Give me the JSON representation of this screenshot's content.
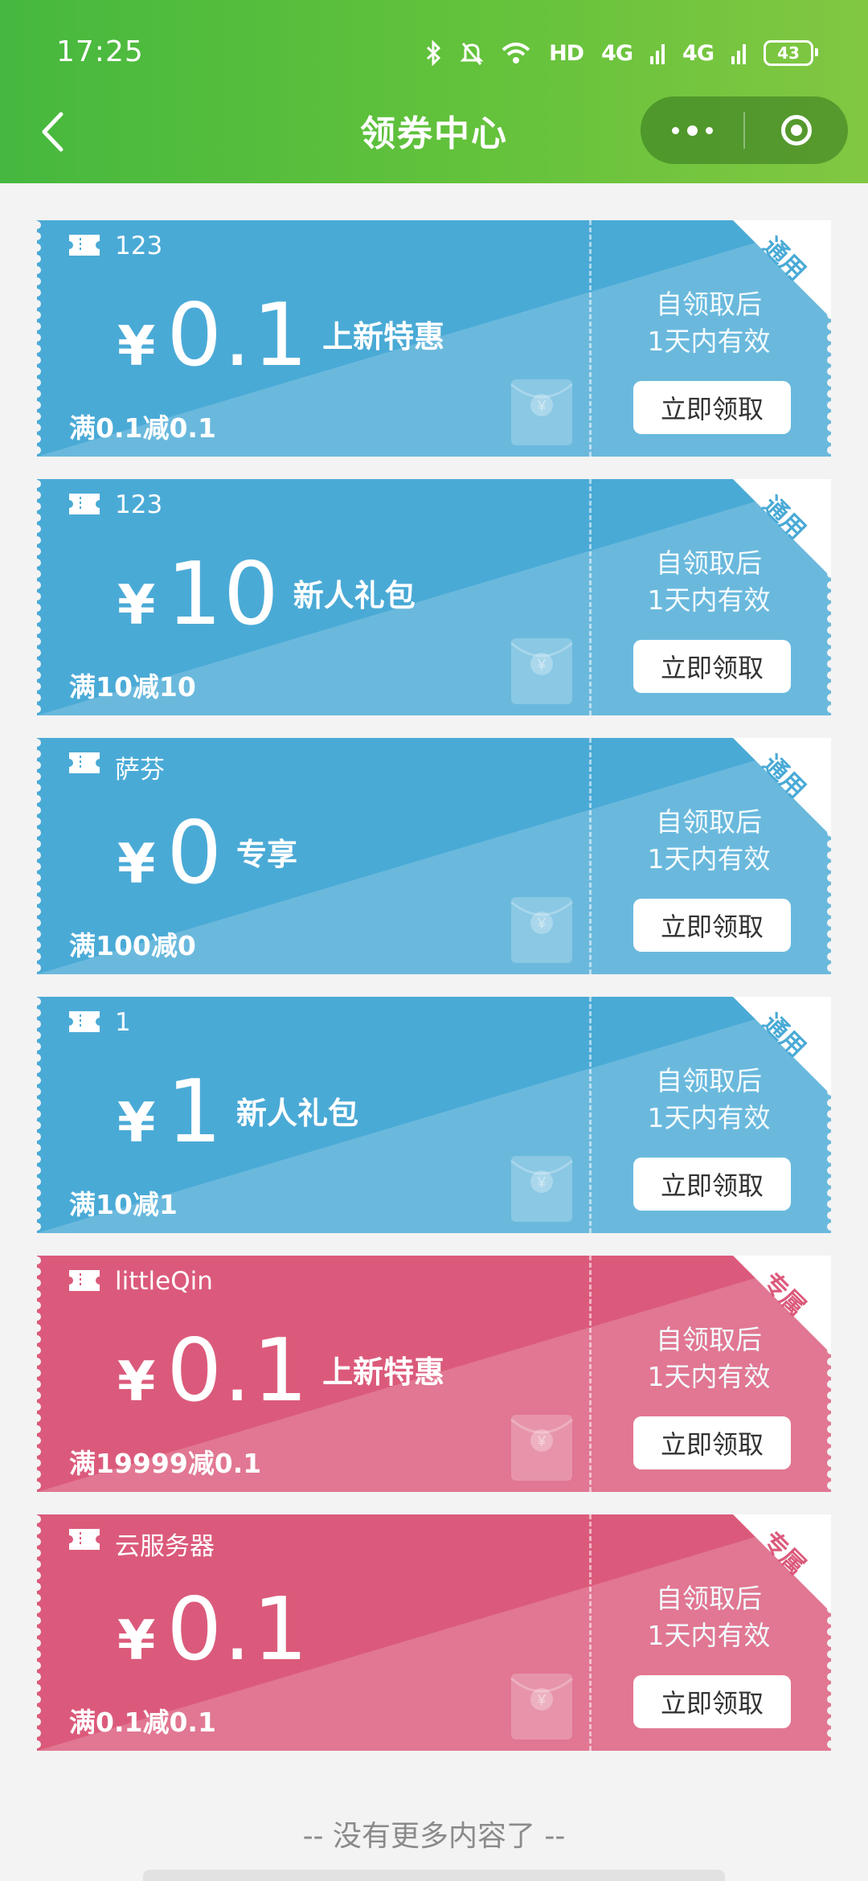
{
  "status_bar": {
    "time": "17:25",
    "hd": "HD",
    "net1": "4G",
    "net2": "4G",
    "battery": "43"
  },
  "header": {
    "title": "领券中心"
  },
  "coupons": [
    {
      "shop": "123",
      "amount": "0.1",
      "tag": "上新特惠",
      "condition": "满0.1减0.1",
      "validity_line1": "自领取后",
      "validity_line2": "1天内有效",
      "button": "立即领取",
      "corner": "通用",
      "theme": "blue"
    },
    {
      "shop": "123",
      "amount": "10",
      "tag": "新人礼包",
      "condition": "满10减10",
      "validity_line1": "自领取后",
      "validity_line2": "1天内有效",
      "button": "立即领取",
      "corner": "通用",
      "theme": "blue"
    },
    {
      "shop": "萨芬",
      "amount": "0",
      "tag": "专享",
      "condition": "满100减0",
      "validity_line1": "自领取后",
      "validity_line2": "1天内有效",
      "button": "立即领取",
      "corner": "通用",
      "theme": "blue"
    },
    {
      "shop": "1",
      "amount": "1",
      "tag": "新人礼包",
      "condition": "满10减1",
      "validity_line1": "自领取后",
      "validity_line2": "1天内有效",
      "button": "立即领取",
      "corner": "通用",
      "theme": "blue"
    },
    {
      "shop": "littleQin",
      "amount": "0.1",
      "tag": "上新特惠",
      "condition": "满19999减0.1",
      "validity_line1": "自领取后",
      "validity_line2": "1天内有效",
      "button": "立即领取",
      "corner": "专属",
      "theme": "pink"
    },
    {
      "shop": "云服务器",
      "amount": "0.1",
      "tag": "",
      "condition": "满0.1减0.1",
      "validity_line1": "自领取后",
      "validity_line2": "1天内有效",
      "button": "立即领取",
      "corner": "专属",
      "theme": "pink"
    }
  ],
  "currency_symbol": "¥",
  "footer": {
    "no_more": "-- 没有更多内容了 --"
  },
  "colors": {
    "header_green": "#46b83f",
    "coupon_blue": "#4aaad6",
    "coupon_pink": "#db5a7b"
  }
}
